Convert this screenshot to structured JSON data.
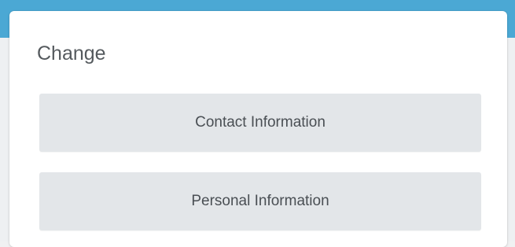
{
  "card": {
    "title": "Change"
  },
  "options": {
    "contact_label": "Contact Information",
    "personal_label": "Personal Information"
  }
}
